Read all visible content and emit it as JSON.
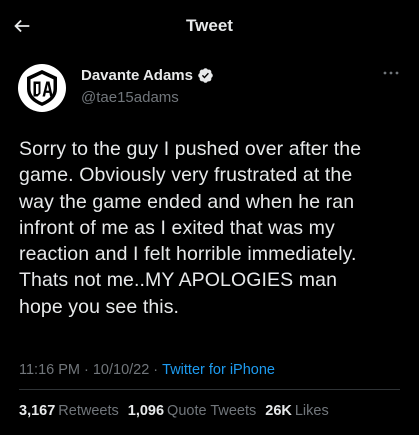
{
  "header": {
    "title": "Tweet",
    "back_icon": "arrow-left-icon"
  },
  "author": {
    "name": "Davante Adams",
    "handle": "@tae15adams",
    "verified_icon": "verified-badge-icon",
    "avatar_icon": "da-logo-icon",
    "more_icon": "more-horizontal-icon"
  },
  "tweet": {
    "text": "Sorry to the guy I pushed over after the\ngame. Obviously very frustrated at the\nway the game ended and when he ran\ninfront of me as I exited that was my\nreaction and I felt horrible immediately.\nThats not me..MY APOLOGIES man\nhope you see this.",
    "time": "11:16 PM",
    "separator": "·",
    "date": "10/10/22",
    "source": "Twitter for iPhone"
  },
  "stats": {
    "retweets_count": "3,167",
    "retweets_label": "Retweets",
    "quotes_count": "1,096",
    "quotes_label": "Quote Tweets",
    "likes_count": "26K",
    "likes_label": "Likes"
  },
  "colors": {
    "background": "#000000",
    "text": "#e7e9ea",
    "secondary_text": "#71767b",
    "accent": "#1d9bf0",
    "divider": "#2f3336"
  }
}
